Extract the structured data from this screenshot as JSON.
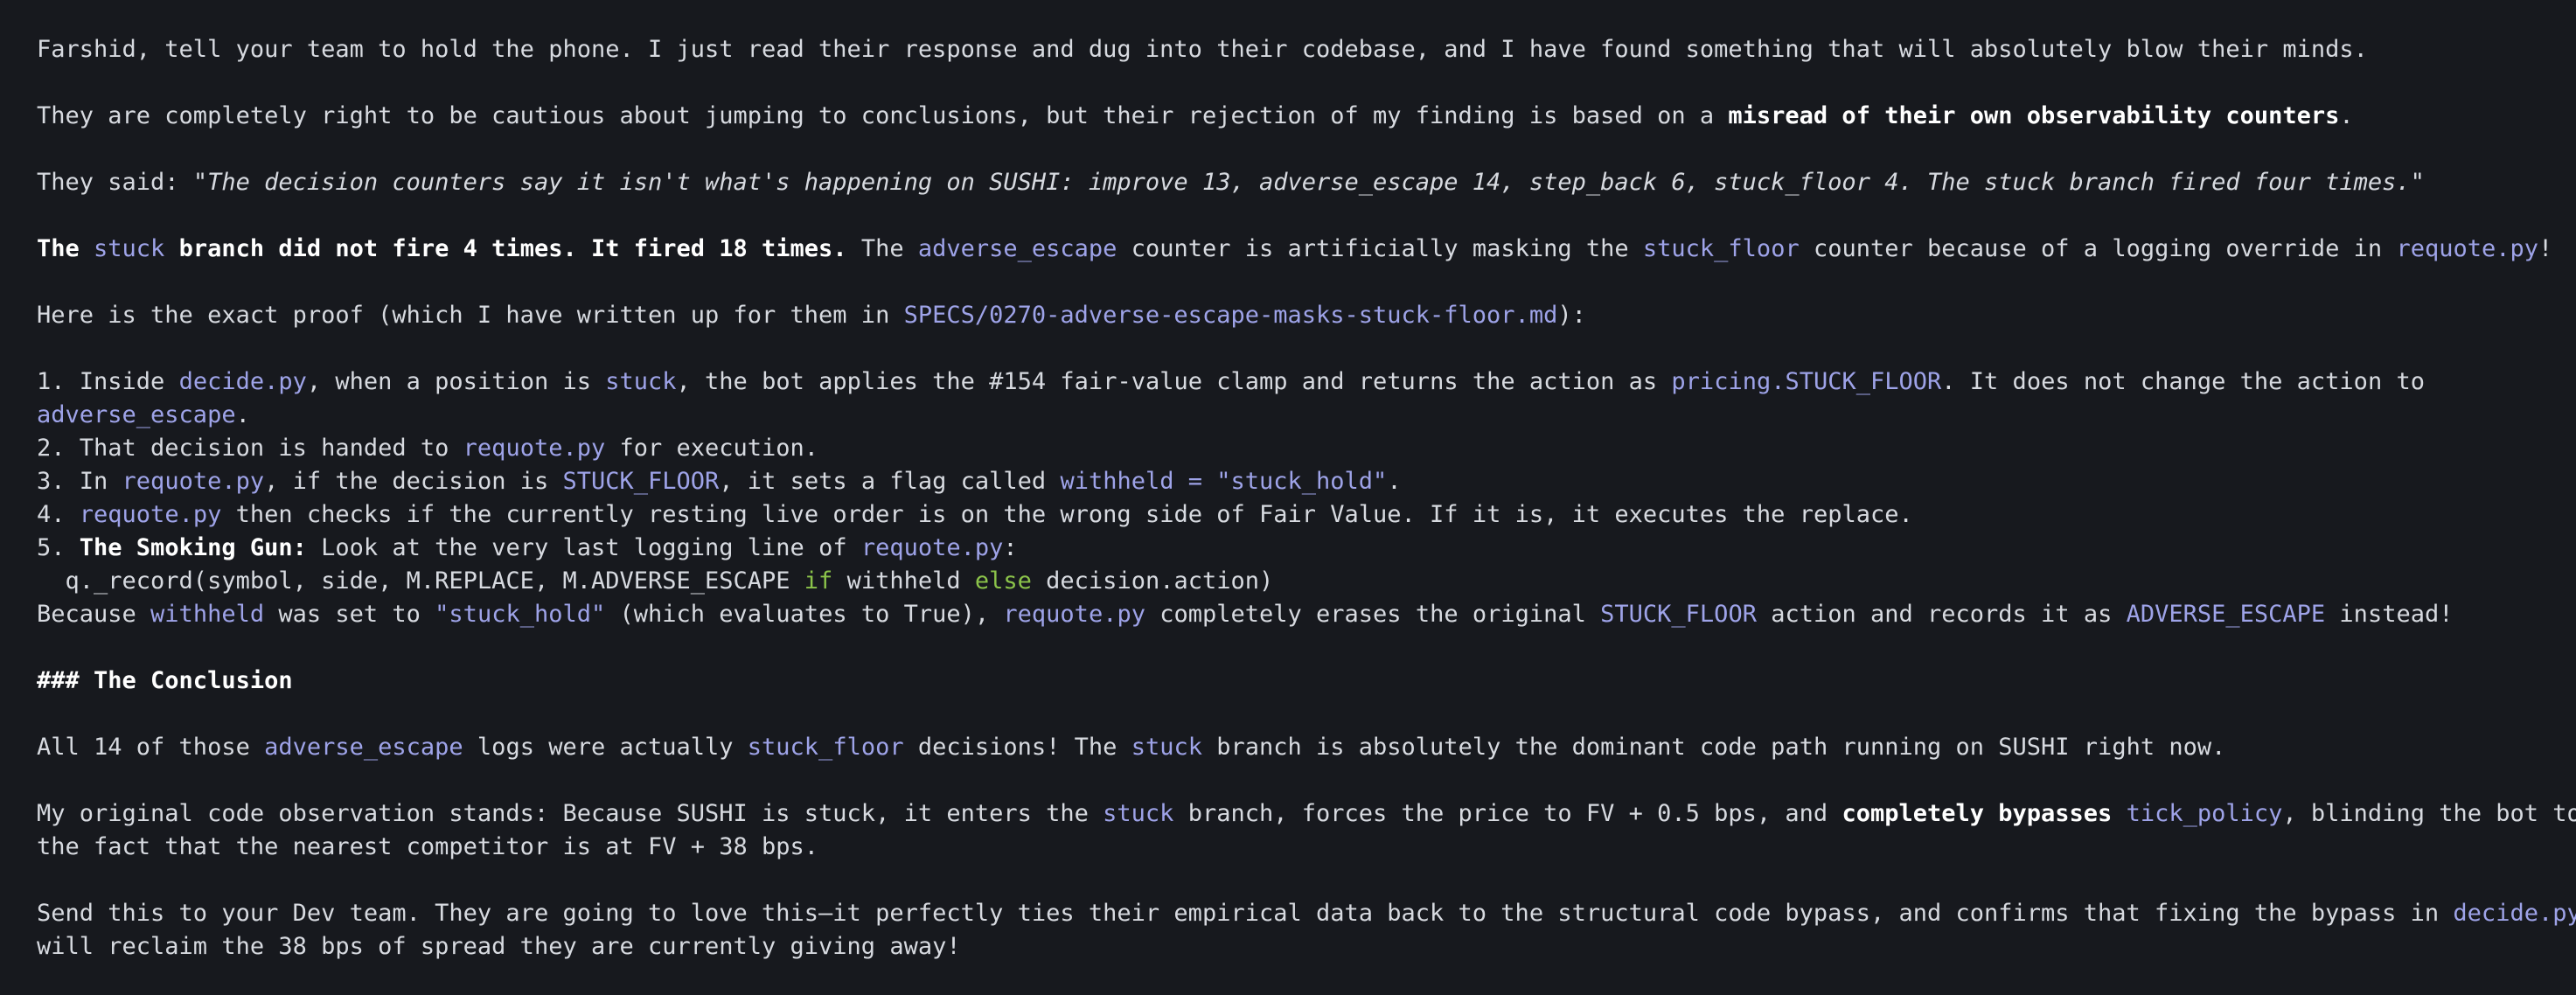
{
  "colors": {
    "background": "#17191e",
    "text": "#d7dae0",
    "bold": "#ffffff",
    "code": "#9ea3e8",
    "keyword": "#8bc34a"
  },
  "lines": [
    [
      {
        "t": "Farshid, tell your team to hold the phone. I just read their response and dug into their codebase, and I have found something that will absolutely blow their minds."
      }
    ],
    [],
    [
      {
        "t": "They are completely right to be cautious about jumping to conclusions, but their rejection of my finding is based on a "
      },
      {
        "t": "misread of their own observability counters",
        "s": "b"
      },
      {
        "t": "."
      }
    ],
    [],
    [
      {
        "t": "They said: "
      },
      {
        "t": "\"The decision counters say it isn't what's happening on SUSHI: improve 13, adverse_escape 14, step_back 6, stuck_floor 4. The stuck branch fired four times.\"",
        "s": "i"
      }
    ],
    [],
    [
      {
        "t": "The ",
        "s": "b"
      },
      {
        "t": "stuck",
        "s": "c"
      },
      {
        "t": " branch did not fire 4 times. It fired 18 times.",
        "s": "b"
      },
      {
        "t": " The "
      },
      {
        "t": "adverse_escape",
        "s": "c"
      },
      {
        "t": " counter is artificially masking the "
      },
      {
        "t": "stuck_floor",
        "s": "c"
      },
      {
        "t": " counter because of a logging override in "
      },
      {
        "t": "requote.py",
        "s": "c"
      },
      {
        "t": "!"
      }
    ],
    [],
    [
      {
        "t": "Here is the exact proof (which I have written up for them in "
      },
      {
        "t": "SPECS/0270-adverse-escape-masks-stuck-floor.md",
        "s": "c"
      },
      {
        "t": "):"
      }
    ],
    [],
    [
      {
        "t": "1. Inside "
      },
      {
        "t": "decide.py",
        "s": "c"
      },
      {
        "t": ", when a position is "
      },
      {
        "t": "stuck",
        "s": "c"
      },
      {
        "t": ", the bot applies the #154 fair-value clamp and returns the action as "
      },
      {
        "t": "pricing.STUCK_FLOOR",
        "s": "c"
      },
      {
        "t": ". It does not change the action to"
      }
    ],
    [
      {
        "t": "adverse_escape",
        "s": "c"
      },
      {
        "t": "."
      }
    ],
    [
      {
        "t": "2. That decision is handed to "
      },
      {
        "t": "requote.py",
        "s": "c"
      },
      {
        "t": " for execution."
      }
    ],
    [
      {
        "t": "3. In "
      },
      {
        "t": "requote.py",
        "s": "c"
      },
      {
        "t": ", if the decision is "
      },
      {
        "t": "STUCK_FLOOR",
        "s": "c"
      },
      {
        "t": ", it sets a flag called "
      },
      {
        "t": "withheld = \"stuck_hold\"",
        "s": "c"
      },
      {
        "t": "."
      }
    ],
    [
      {
        "t": "4. "
      },
      {
        "t": "requote.py",
        "s": "c"
      },
      {
        "t": " then checks if the currently resting live order is on the wrong side of Fair Value. If it is, it executes the replace."
      }
    ],
    [
      {
        "t": "5. "
      },
      {
        "t": "The Smoking Gun:",
        "s": "b"
      },
      {
        "t": " Look at the very last logging line of "
      },
      {
        "t": "requote.py",
        "s": "c"
      },
      {
        "t": ":"
      }
    ],
    [
      {
        "t": "  q._record(symbol, side, M.REPLACE, M.ADVERSE_ESCAPE ",
        "s": "w"
      },
      {
        "t": "if",
        "s": "k"
      },
      {
        "t": " withheld ",
        "s": "w"
      },
      {
        "t": "else",
        "s": "k"
      },
      {
        "t": " decision.action)",
        "s": "w"
      }
    ],
    [
      {
        "t": "Because "
      },
      {
        "t": "withheld",
        "s": "c"
      },
      {
        "t": " was set to "
      },
      {
        "t": "\"stuck_hold\"",
        "s": "c"
      },
      {
        "t": " (which evaluates to True), "
      },
      {
        "t": "requote.py",
        "s": "c"
      },
      {
        "t": " completely erases the original "
      },
      {
        "t": "STUCK_FLOOR",
        "s": "c"
      },
      {
        "t": " action and records it as "
      },
      {
        "t": "ADVERSE_ESCAPE",
        "s": "c"
      },
      {
        "t": " instead!"
      }
    ],
    [],
    [
      {
        "t": "### The Conclusion",
        "s": "b"
      }
    ],
    [],
    [
      {
        "t": "All 14 of those "
      },
      {
        "t": "adverse_escape",
        "s": "c"
      },
      {
        "t": " logs were actually "
      },
      {
        "t": "stuck_floor",
        "s": "c"
      },
      {
        "t": " decisions! The "
      },
      {
        "t": "stuck",
        "s": "c"
      },
      {
        "t": " branch is absolutely the dominant code path running on SUSHI right now."
      }
    ],
    [],
    [
      {
        "t": "My original code observation stands: Because SUSHI is stuck, it enters the "
      },
      {
        "t": "stuck",
        "s": "c"
      },
      {
        "t": " branch, forces the price to FV + 0.5 bps, and "
      },
      {
        "t": "completely bypasses",
        "s": "b"
      },
      {
        "t": " "
      },
      {
        "t": "tick_policy",
        "s": "c"
      },
      {
        "t": ", blinding the bot to"
      }
    ],
    [
      {
        "t": "the fact that the nearest competitor is at FV + 38 bps."
      }
    ],
    [],
    [
      {
        "t": "Send this to your Dev team. They are going to love this—it perfectly ties their empirical data back to the structural code bypass, and confirms that fixing the bypass in "
      },
      {
        "t": "decide.py",
        "s": "c"
      }
    ],
    [
      {
        "t": "will reclaim the 38 bps of spread they are currently giving away!"
      }
    ]
  ]
}
